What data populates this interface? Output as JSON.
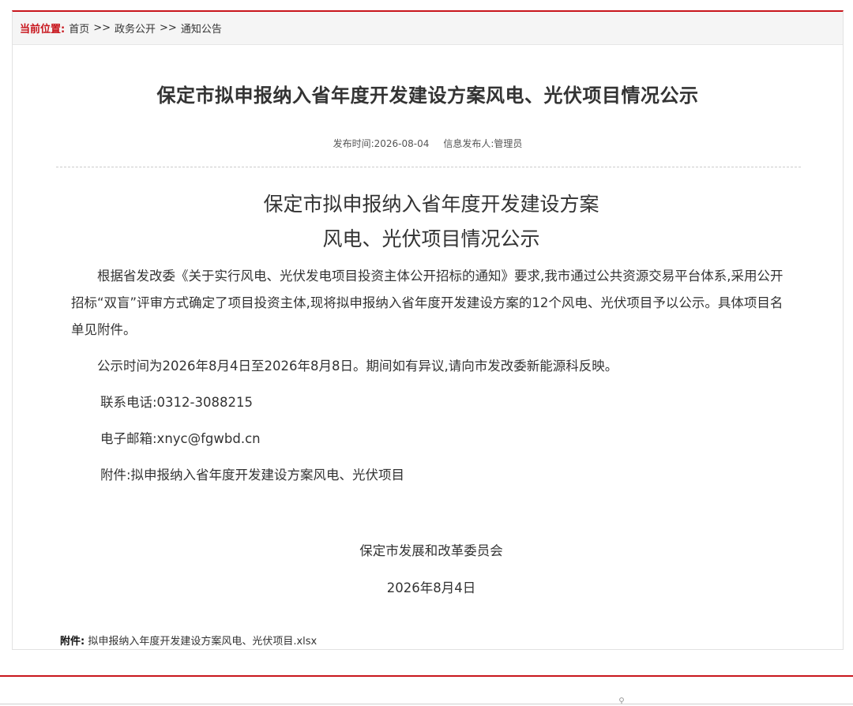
{
  "breadcrumb": {
    "label": "当前位置:",
    "items": [
      "首页",
      "政务公开",
      "通知公告"
    ],
    "separator": ">>"
  },
  "article": {
    "headline": "保定市拟申报纳入省年度开发建设方案风电、光伏项目情况公示",
    "publish_time": "发布时间:2026-08-04",
    "publisher": "信息发布人:管理员"
  },
  "document": {
    "title_lines": [
      "保定市拟申报纳入省年度开发建设方案",
      "风电、光伏项目情况公示"
    ],
    "paragraphs": [
      "根据省发改委《关于实行风电、光伏发电项目投资主体公开招标的通知》要求,我市通过公共资源交易平台体系,采用公开招标“双盲”评审方式确定了项目投资主体,现将拟申报纳入省年度开发建设方案的12个风电、光伏项目予以公示。具体项目名单见附件。",
      "公示时间为2026年8月4日至2026年8月8日。期间如有异议,请向市发改委新能源科反映。"
    ],
    "phone": "联系电话:0312-3088215",
    "email": "电子邮箱:xnyc@fgwbd.cn",
    "attachment_note": "附件:拟申报纳入省年度开发建设方案风电、光伏项目",
    "signature_org": "保定市发展和改革委员会",
    "signature_date": "2026年8月4日"
  },
  "attachment": {
    "label": "附件:",
    "file": "拟申报纳入年度开发建设方案风电、光伏项目.xlsx"
  },
  "colors": {
    "accent": "#c8161d",
    "text": "#333333",
    "crumb_bg": "#f5f5f5"
  },
  "icons": {
    "footer": "map-pin-icon"
  }
}
